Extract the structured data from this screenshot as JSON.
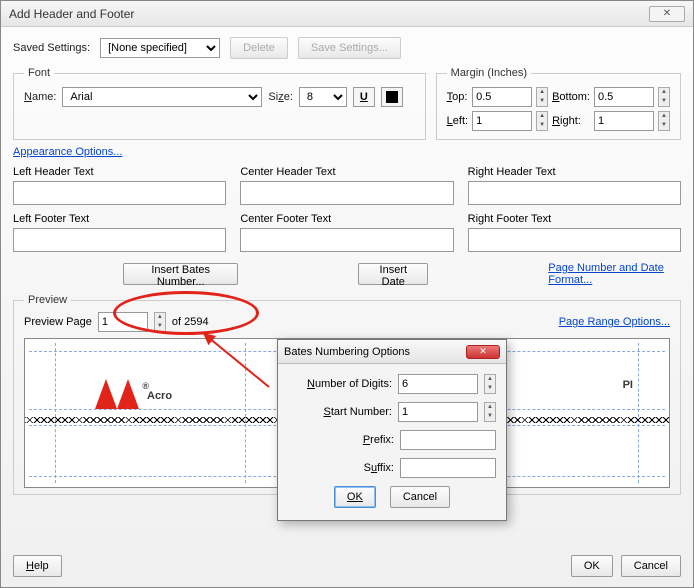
{
  "window": {
    "title": "Add Header and Footer"
  },
  "saved": {
    "label": "Saved Settings:",
    "value": "[None specified]",
    "delete": "Delete",
    "save": "Save Settings..."
  },
  "font": {
    "legend": "Font",
    "name_label": "Name:",
    "name_value": "Arial",
    "size_label": "Size:",
    "size_value": "8"
  },
  "margin": {
    "legend": "Margin (Inches)",
    "top_label": "Top:",
    "top_value": "0.5",
    "bottom_label": "Bottom:",
    "bottom_value": "0.5",
    "left_label": "Left:",
    "left_value": "1",
    "right_label": "Right:",
    "right_value": "1"
  },
  "appearance_link": "Appearance Options...",
  "hf": {
    "lh": "Left Header Text",
    "ch": "Center Header Text",
    "rh": "Right Header Text",
    "lf": "Left Footer Text",
    "cf": "Center Footer Text",
    "rf": "Right Footer Text"
  },
  "buttons": {
    "insert_bates": "Insert Bates Number...",
    "insert_date": "Insert Date",
    "page_format_link": "Page Number and Date Format...",
    "help": "Help",
    "ok": "OK",
    "cancel": "Cancel"
  },
  "preview": {
    "legend": "Preview",
    "page_label": "Preview Page",
    "page_value": "1",
    "total": "of 2594",
    "range_link": "Page Range Options...",
    "sample_text_left": "Acro",
    "sample_text_right": "PI"
  },
  "bates_dialog": {
    "title": "Bates Numbering Options",
    "digits_label": "Number of Digits:",
    "digits_value": "6",
    "start_label": "Start Number:",
    "start_value": "1",
    "prefix_label": "Prefix:",
    "prefix_value": "",
    "suffix_label": "Suffix:",
    "suffix_value": "",
    "ok": "OK",
    "cancel": "Cancel"
  }
}
